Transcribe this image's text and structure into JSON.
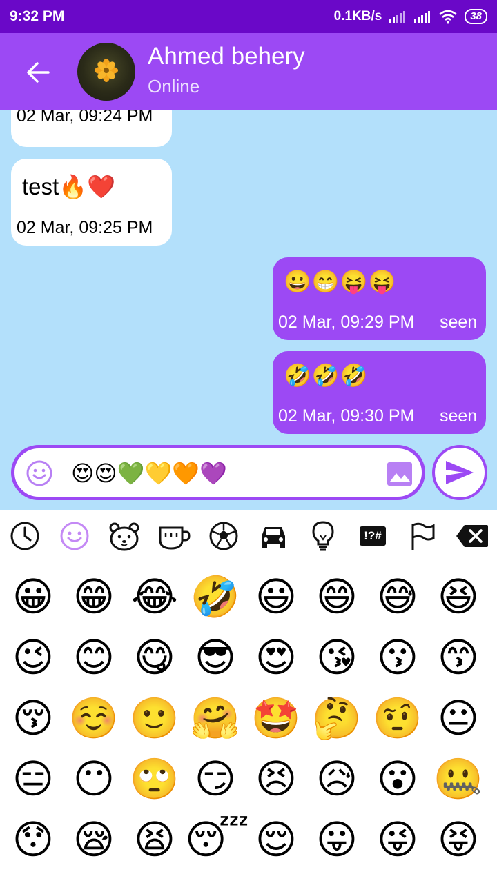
{
  "status_bar": {
    "time": "9:32 PM",
    "net_speed": "0.1KB/s",
    "battery": "38"
  },
  "header": {
    "name": "Ahmed behery",
    "status": "Online"
  },
  "messages": [
    {
      "dir": "in",
      "time": "02 Mar, 09:24 PM"
    },
    {
      "dir": "in",
      "text": "test🔥❤️",
      "time": "02 Mar, 09:25 PM"
    },
    {
      "dir": "out",
      "text": "😀😁😝😝",
      "time": "02 Mar, 09:29 PM",
      "status": "seen"
    },
    {
      "dir": "out",
      "text": "🤣🤣🤣",
      "time": "02 Mar, 09:30 PM",
      "status": "seen"
    }
  ],
  "composer": {
    "value": "😍😍💚💛🧡💜"
  },
  "keyboard": {
    "tabs": [
      "recent-icon",
      "smileys-icon",
      "animals-icon",
      "food-icon",
      "activity-icon",
      "travel-icon",
      "objects-icon",
      "symbols-icon",
      "flags-icon",
      "backspace-icon"
    ],
    "symbols_label": "!?#",
    "emojis": [
      "😀",
      "😁",
      "😂",
      "🤣",
      "😃",
      "😄",
      "😅",
      "😆",
      "😉",
      "😊",
      "😋",
      "😎",
      "😍",
      "😘",
      "😗",
      "😙",
      "😚",
      "☺️",
      "🙂",
      "🤗",
      "🤩",
      "🤔",
      "🤨",
      "😐",
      "😑",
      "😶",
      "🙄",
      "😏",
      "😣",
      "😥",
      "😮",
      "🤐",
      "😯",
      "😪",
      "😫",
      "😴",
      "😌",
      "😛",
      "😜",
      "😝"
    ]
  },
  "colors": {
    "primary": "#9c49f4",
    "status_bar": "#6a08c8",
    "chat_bg": "#b3e0fb"
  }
}
